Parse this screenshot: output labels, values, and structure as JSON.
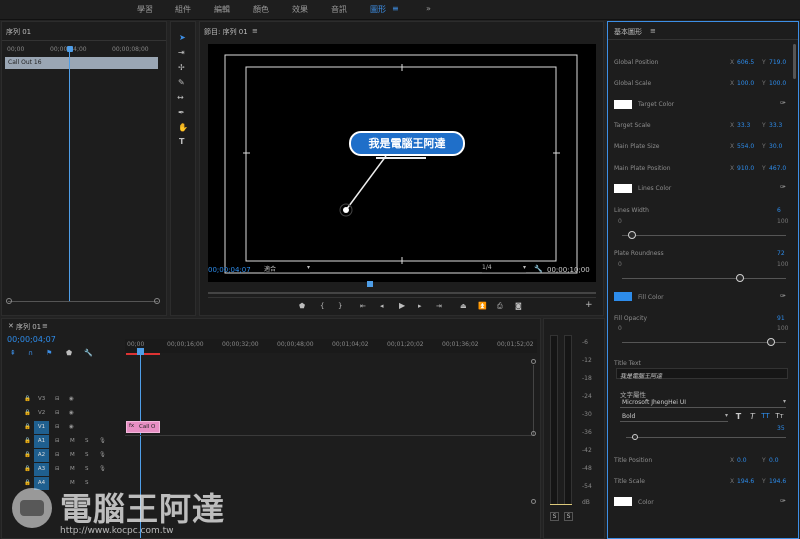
{
  "workspaces": [
    "學習",
    "組件",
    "編輯",
    "顏色",
    "效果",
    "音訊",
    "圖形"
  ],
  "active_workspace": "圖形",
  "menu_glyph": "≡",
  "more_glyph": "»",
  "source": {
    "title": "序列 01",
    "ruler": [
      "00;00",
      "00;00;04;00",
      "00;00;08;00"
    ],
    "clip": "Call Out 16"
  },
  "program": {
    "title": "節目: 序列 01",
    "callout_text": "我是電腦王阿達",
    "timecode": "00;00;04;07",
    "fit": "適合",
    "resolution": "1/4",
    "duration": "00;00;10;00"
  },
  "timeline": {
    "title": "序列 01",
    "timecode": "00;00;04;07",
    "ruler": [
      "00;00",
      "00;00;16;00",
      "00;00;32;00",
      "00;00;48;00",
      "00;01;04;02",
      "00;01;20;02",
      "00;01;36;02",
      "00;01;52;02"
    ],
    "tracks": [
      "V3",
      "V2",
      "V1",
      "A1",
      "A2",
      "A3",
      "A4"
    ],
    "clip_label": "Call O",
    "meter_labels": [
      "S",
      "S"
    ],
    "meter_scale": [
      "-6",
      "-12",
      "-18",
      "-24",
      "-30",
      "-36",
      "-42",
      "-48",
      "-54",
      "dB"
    ]
  },
  "essential": {
    "title": "基本圖形",
    "global_position": {
      "label": "Global Position",
      "x": "606.5",
      "y": "719.0"
    },
    "global_scale": {
      "label": "Global Scale",
      "x": "100.0",
      "y": "100.0"
    },
    "target_color": "Target Color",
    "target_scale": {
      "label": "Target Scale",
      "x": "33.3",
      "y": "33.3"
    },
    "main_plate_size": {
      "label": "Main Plate Size",
      "x": "554.0",
      "y": "30.0"
    },
    "main_plate_position": {
      "label": "Main Plate Position",
      "x": "910.0",
      "y": "467.0"
    },
    "lines_color": "Lines Color",
    "lines_width": {
      "label": "Lines Width",
      "value": "6",
      "min": "0",
      "max": "100",
      "fraction": 0.06
    },
    "plate_roundness": {
      "label": "Plate Roundness",
      "value": "72",
      "min": "0",
      "max": "100",
      "fraction": 0.72
    },
    "fill_color": "Fill Color",
    "fill_opacity": {
      "label": "Fill Opacity",
      "value": "91",
      "min": "0",
      "max": "100",
      "fraction": 0.91
    },
    "title_text_label": "Title Text",
    "title_text_value": "我是電腦王阿達",
    "text_props_label": "文字屬性",
    "font_family": "Microsoft JhengHei UI",
    "font_style": "Bold",
    "font_size": "35",
    "style_buttons": [
      "T",
      "T",
      "TT",
      "Tт"
    ],
    "title_position": {
      "label": "Title Position",
      "x": "0.0",
      "y": "0.0"
    },
    "title_scale": {
      "label": "Title Scale",
      "x": "194.6",
      "y": "194.6"
    },
    "color_label": "Color",
    "x_label": "X",
    "y_label": "Y"
  },
  "watermark": {
    "brand": "電腦王阿達",
    "url": "http://www.kocpc.com.tw"
  },
  "colors": {
    "accent": "#2d8ceb",
    "clip_pink": "#e88fc4",
    "playhead": "#4f9ee8"
  }
}
